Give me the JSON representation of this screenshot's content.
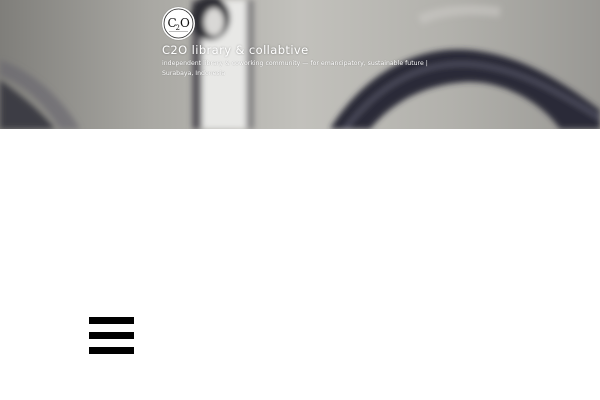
{
  "header": {
    "site_title": "C2O library & collabtive",
    "site_description": "independent library & coworking community — for emancipatory, sustainable future | Surabaya, Indonesia",
    "logo_alt_text": "C2O"
  },
  "menu": {
    "toggle_icon": "hamburger-menu-icon"
  },
  "colors": {
    "header_text": "#ffffff",
    "menu_icon": "#000000",
    "page_background": "#ffffff"
  }
}
